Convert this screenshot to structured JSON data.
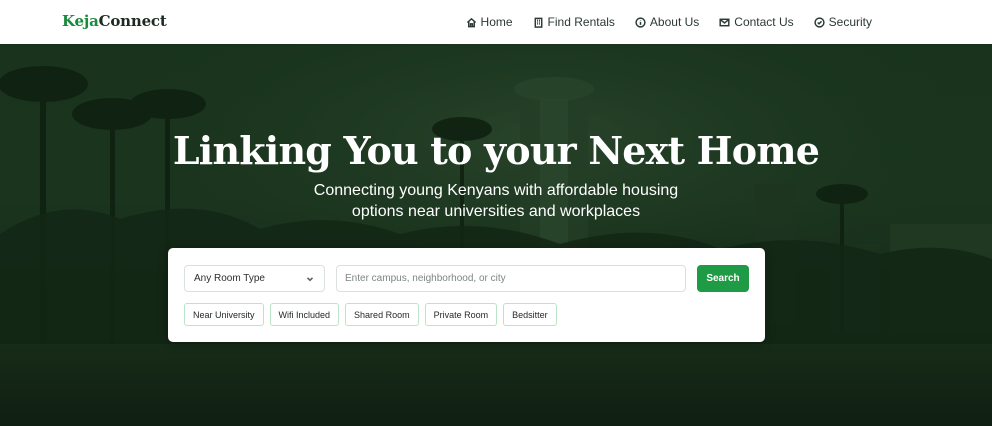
{
  "brand": {
    "part1": "Keja",
    "part2": "Connect"
  },
  "nav": [
    {
      "label": "Home",
      "icon": "home-icon"
    },
    {
      "label": "Find Rentals",
      "icon": "building-icon"
    },
    {
      "label": "About Us",
      "icon": "info-icon"
    },
    {
      "label": "Contact Us",
      "icon": "mail-icon"
    },
    {
      "label": "Security",
      "icon": "shield-check-icon"
    }
  ],
  "hero": {
    "title": "Linking You to your Next Home",
    "subtitle_line1": "Connecting young Kenyans with affordable housing",
    "subtitle_line2": "options near universities and workplaces"
  },
  "search": {
    "room_type_selected": "Any Room Type",
    "placeholder": "Enter campus, neighborhood, or city",
    "button_label": "Search",
    "tags": [
      "Near University",
      "Wifi Included",
      "Shared Room",
      "Private Room",
      "Bedsitter"
    ]
  },
  "colors": {
    "brand_green": "#1a8a3c",
    "button_green": "#1f9a45",
    "hero_overlay": "#1e3a22"
  }
}
